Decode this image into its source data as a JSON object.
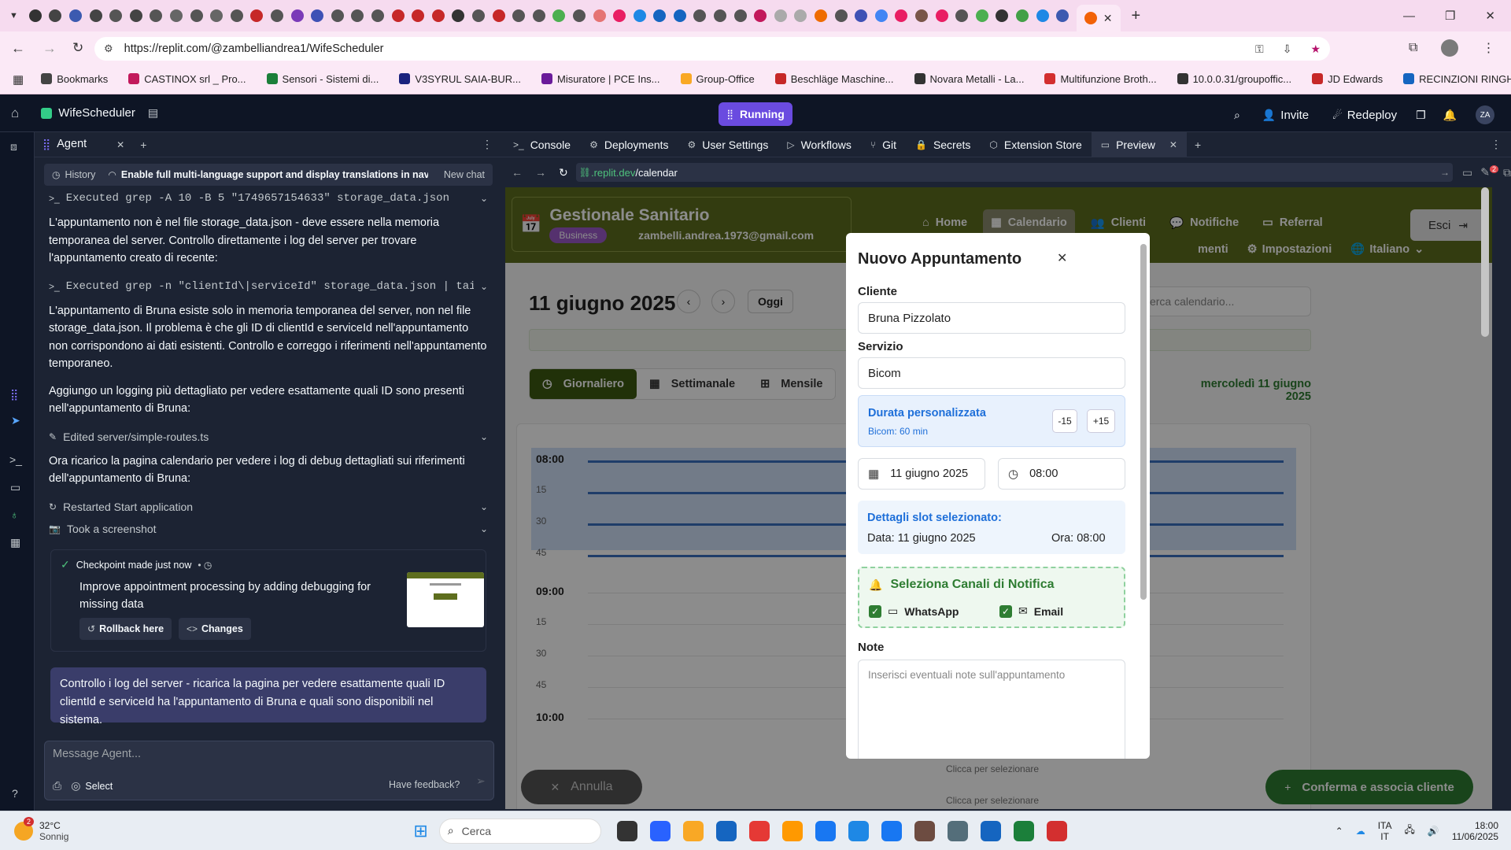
{
  "browser": {
    "url": "https://replit.com/@zambelliandrea1/WifeScheduler",
    "bookmarks": [
      "Bookmarks",
      "CASTINOX srl _ Pro...",
      "Sensori - Sistemi di...",
      "V3SYRUL SAIA-BUR...",
      "Misuratore | PCE Ins...",
      "Group-Office",
      "Beschläge Maschine...",
      "Novara Metalli - La...",
      "Multifunzione Broth...",
      "10.0.0.31/groupoffic...",
      "JD Edwards",
      "RECINZIONI RINGHI..."
    ],
    "colors": {
      "tabstrip": "#f6dbef",
      "toolbar": "#fbe9f6",
      "accent": "#b5126b"
    }
  },
  "replit": {
    "project": "WifeScheduler",
    "status": "Running",
    "invite": "Invite",
    "redeploy": "Redeploy",
    "avatar": "ZA",
    "colors": {
      "bg": "#0e1525",
      "panel": "#1c2333",
      "running": "#6a4be0"
    }
  },
  "agent": {
    "tab": "Agent",
    "history": "History",
    "chat_title": "Enable full multi-language support and display translations in naviga...",
    "new_chat": "New chat",
    "log": [
      {
        "kind": "cmd",
        "text": "Executed grep -A 10 -B 5 \"1749657154633\" storage_data.json"
      },
      {
        "kind": "msg",
        "text": "L'appuntamento non è nel file storage_data.json - deve essere nella memoria temporanea del server. Controllo direttamente i log del server per trovare l'appuntamento creato di recente:"
      },
      {
        "kind": "cmd",
        "text": "Executed grep -n \"clientId\\|serviceId\" storage_data.json | tail..."
      },
      {
        "kind": "msg",
        "text": "L'appuntamento di Bruna esiste solo in memoria temporanea del server, non nel file storage_data.json. Il problema è che gli ID di clientId e serviceId nell'appuntamento non corrispondono ai dati esistenti. Controllo e correggo i riferimenti nell'appuntamento temporaneo."
      },
      {
        "kind": "msg",
        "text": "Aggiungo un logging più dettagliato per vedere esattamente quali ID sono presenti nell'appuntamento di Bruna:"
      },
      {
        "kind": "edit",
        "text": "Edited server/simple-routes.ts"
      },
      {
        "kind": "msg",
        "text": "Ora ricarico la pagina calendario per vedere i log di debug dettagliati sui riferimenti dell'appuntamento di Bruna:"
      },
      {
        "kind": "restart",
        "text": "Restarted Start application"
      },
      {
        "kind": "shot",
        "text": "Took a screenshot"
      }
    ],
    "checkpoint": {
      "title": "Checkpoint made just now",
      "desc": "Improve appointment processing by adding debugging for missing data",
      "rollback": "Rollback here",
      "changes": "Changes"
    },
    "user_msg": "Controllo i log del server - ricarica la pagina per vedere esattamente quali ID clientId e serviceId ha l'appuntamento di Bruna e quali sono disponibili nel sistema.",
    "input_placeholder": "Message Agent...",
    "select": "Select",
    "feedback": "Have feedback?"
  },
  "tabs": [
    "Console",
    "Deployments",
    "User Settings",
    "Workflows",
    "Git",
    "Secrets",
    "Extension Store",
    "Preview"
  ],
  "preview": {
    "url_host": ".replit.dev",
    "url_path": "/calendar",
    "app": {
      "title": "Gestionale Sanitario",
      "badge": "Business",
      "email": "zambelli.andrea.1973@gmail.com",
      "nav": [
        "Home",
        "Calendario",
        "Clienti",
        "Notifiche",
        "Referral"
      ],
      "nav2": [
        "menti",
        "Impostazioni",
        "Italiano"
      ],
      "logout": "Esci",
      "date_title": "11 giugno 2025",
      "today": "Oggi",
      "search_placeholder": "Cerca calendario...",
      "views": [
        "Giornaliero",
        "Settimanale",
        "Mensile"
      ],
      "day_label": "mercoledì 11 giugno 2025",
      "times": [
        "08:00",
        "15",
        "30",
        "45",
        "09:00",
        "15",
        "30",
        "45",
        "10:00"
      ],
      "select_hint": "Clicca per selezionare",
      "cancel": "Annulla",
      "confirm": "Conferma e associa cliente",
      "colors": {
        "header": "#5e6e1e",
        "green": "#2e7d32",
        "active": "#3d5a12"
      }
    },
    "modal": {
      "title": "Nuovo Appuntamento",
      "client_label": "Cliente",
      "client_value": "Bruna Pizzolato",
      "service_label": "Servizio",
      "service_value": "Bicom",
      "duration_title": "Durata personalizzata",
      "duration_sub": "Bicom: 60 min",
      "minus": "-15",
      "plus": "+15",
      "date_value": "11 giugno 2025",
      "time_value": "08:00",
      "slot_title": "Dettagli slot selezionato:",
      "slot_date": "Data: 11 giugno 2025",
      "slot_time": "Ora: 08:00",
      "notify_title": "Seleziona Canali di Notifica",
      "whatsapp": "WhatsApp",
      "email": "Email",
      "notes_label": "Note",
      "notes_placeholder": "Inserisci eventuali note sull'appuntamento"
    }
  },
  "taskbar": {
    "temp": "32°C",
    "weather": "Sonnig",
    "weather_badge": "2",
    "search": "Cerca",
    "lang1": "ITA",
    "lang2": "IT",
    "time": "18:00",
    "date": "11/06/2025"
  }
}
